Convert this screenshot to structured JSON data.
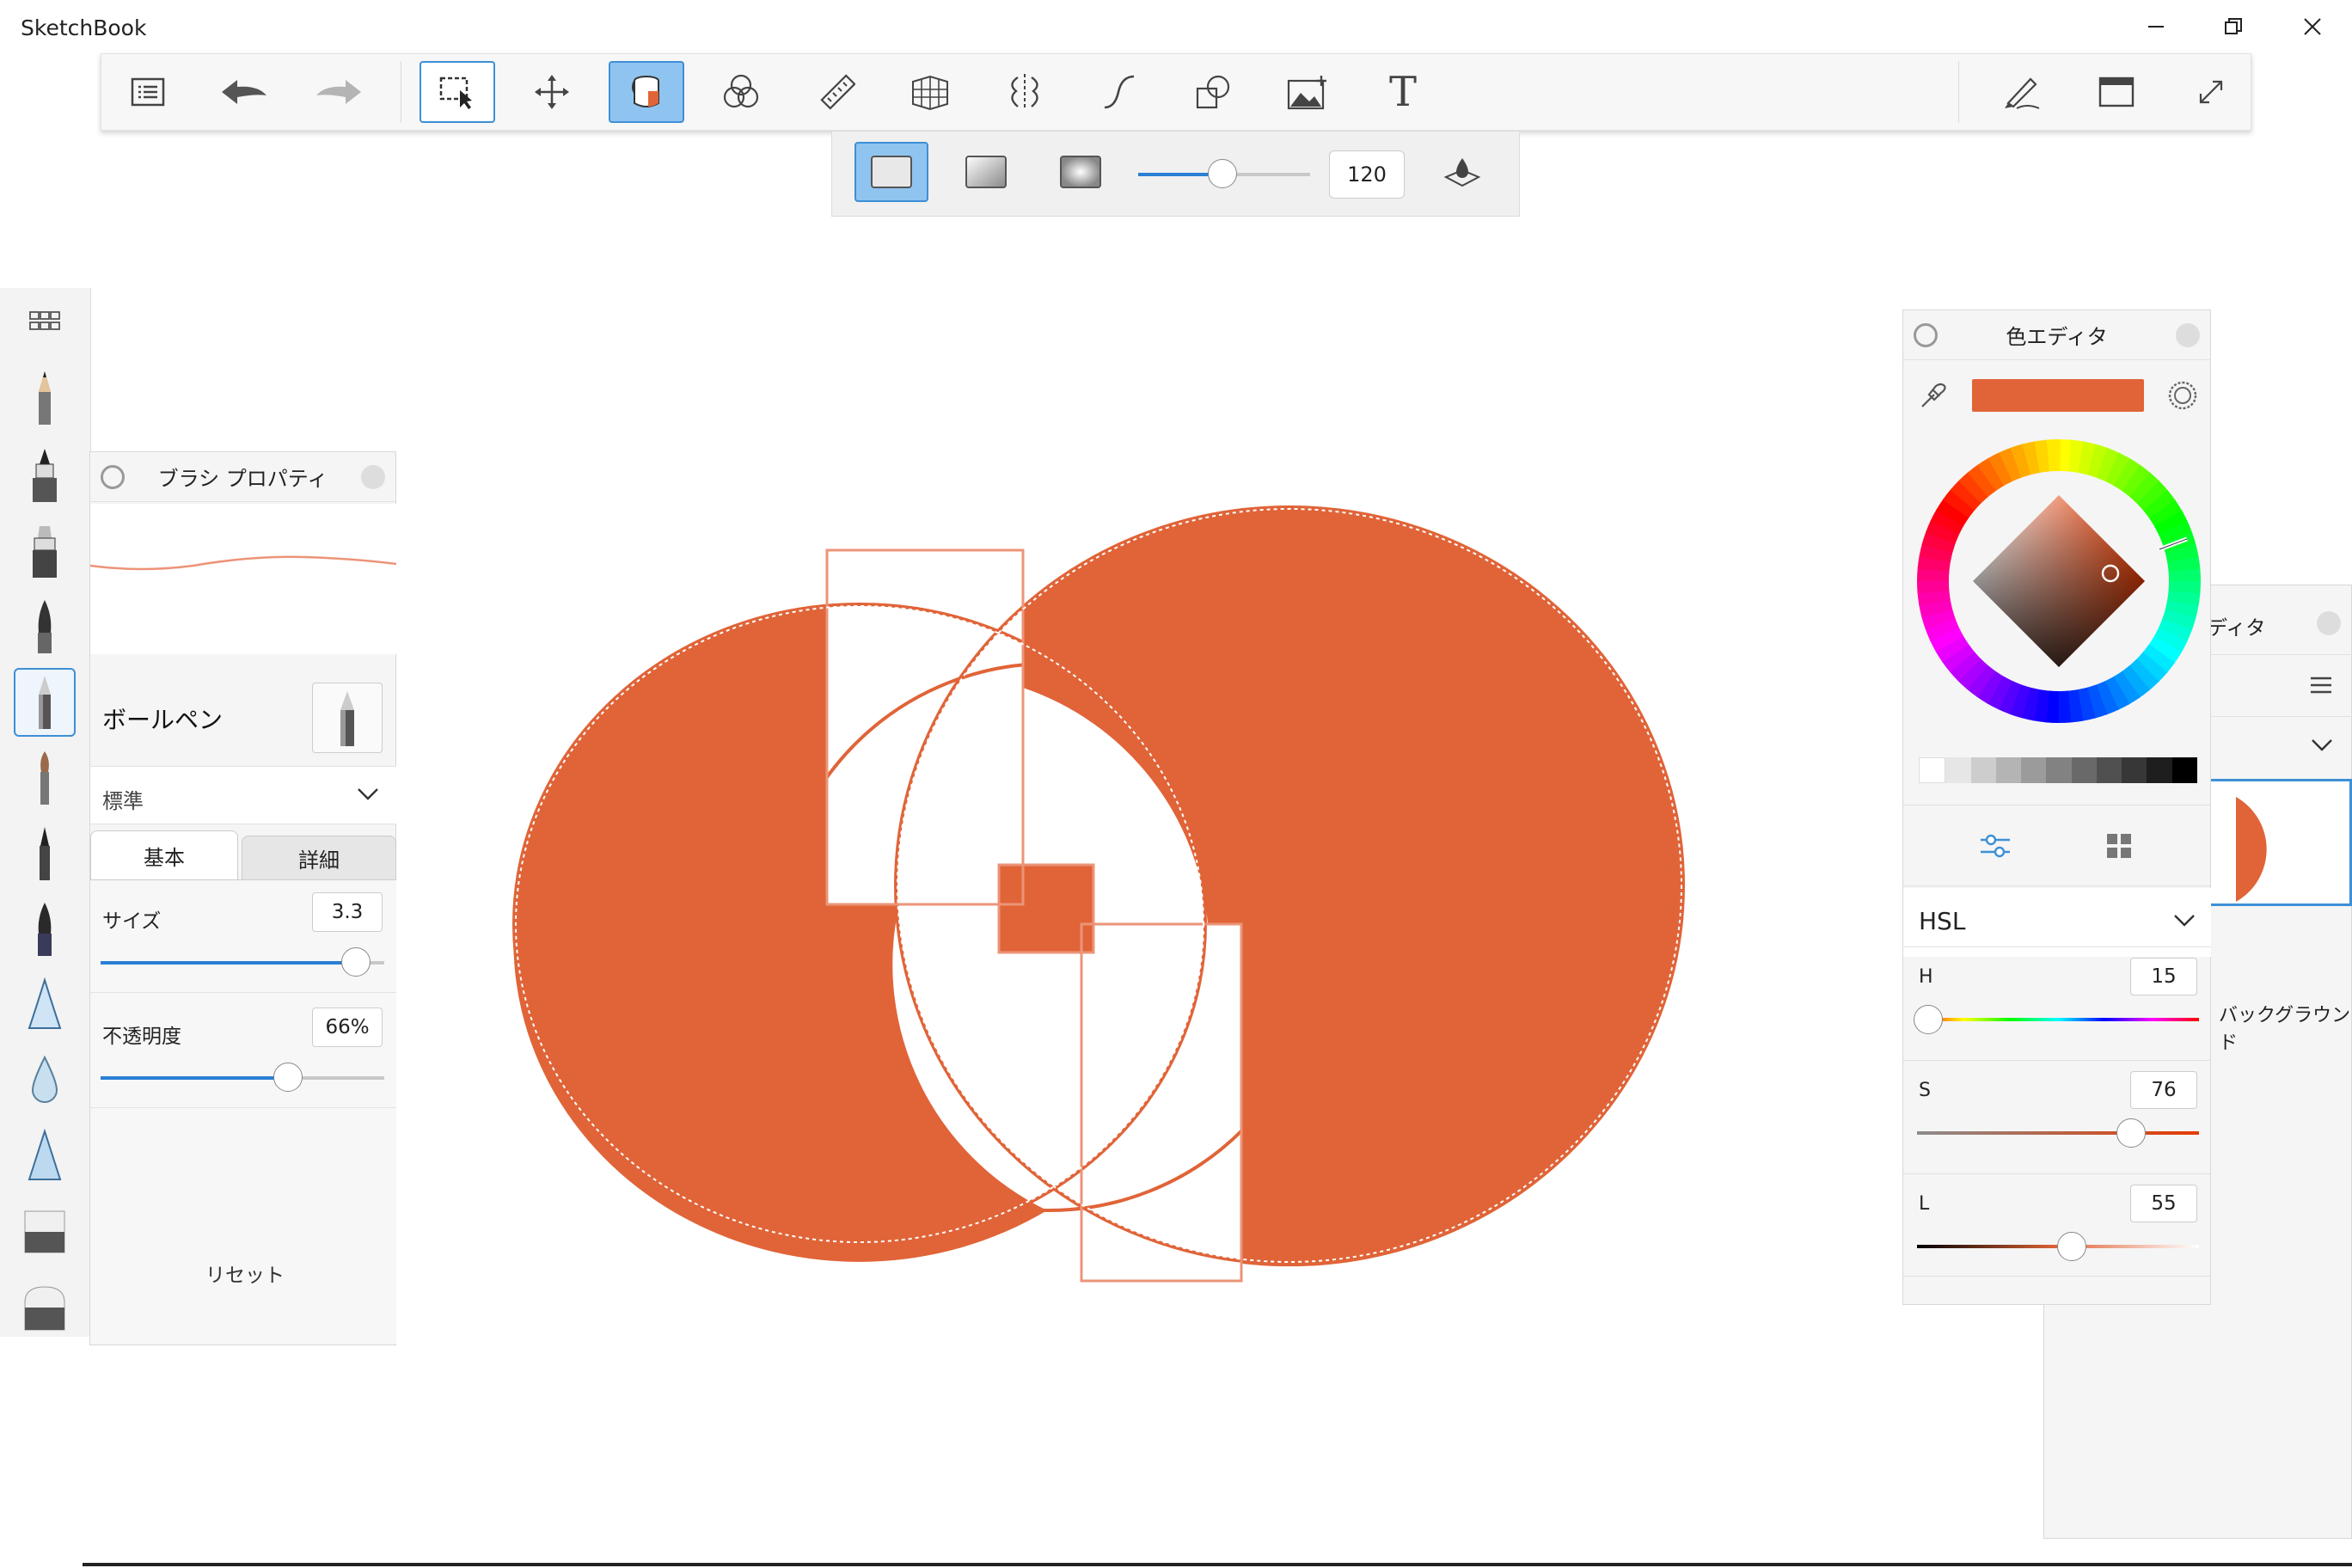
{
  "app": {
    "title": "SketchBook"
  },
  "window_controls": {
    "minimize_icon": "minimize-icon",
    "restore_icon": "restore-icon",
    "close_icon": "close-icon"
  },
  "toolbar": {
    "tools": [
      "menu-icon",
      "undo-icon",
      "redo-icon",
      "selection-icon",
      "move-transform-icon",
      "fill-bucket-icon",
      "color-blend-icon",
      "ruler-icon",
      "perspective-guide-icon",
      "symmetry-icon",
      "curve-icon",
      "shapes-icon",
      "add-image-icon",
      "text-icon",
      "brush-toggle-icon",
      "window-toggle-icon",
      "fullscreen-icon"
    ],
    "selected_tool": "fill-bucket",
    "text_tool_glyph": "T"
  },
  "fill_toolbar": {
    "modes": [
      "solid-fill",
      "linear-gradient",
      "radial-gradient"
    ],
    "selected_mode": "solid-fill",
    "tolerance_value": "120",
    "tolerance_fraction": 0.49
  },
  "brush_panel": {
    "title": "ブラシ プロパティ",
    "brush_name": "ボールペン",
    "preset": "標準",
    "tabs": {
      "basic": "基本",
      "detail": "詳細"
    },
    "size": {
      "label": "サイズ",
      "value": "3.3",
      "fraction": 0.9
    },
    "opacity": {
      "label": "不透明度",
      "value": "66%",
      "fraction": 0.66
    },
    "reset_label": "リセット"
  },
  "layer_panel": {
    "title_fragment": "ディタ",
    "background_label": "バックグラウンド"
  },
  "color_editor": {
    "title": "色エディタ",
    "current_color": "#e06438",
    "mode": "HSL",
    "h": {
      "label": "H",
      "value": "15",
      "fraction": 0.04
    },
    "s": {
      "label": "S",
      "value": "76",
      "fraction": 0.76
    },
    "l": {
      "label": "L",
      "value": "55",
      "fraction": 0.55
    }
  },
  "colors": {
    "accent": "#3d8fd6",
    "paint": "#e06438"
  }
}
